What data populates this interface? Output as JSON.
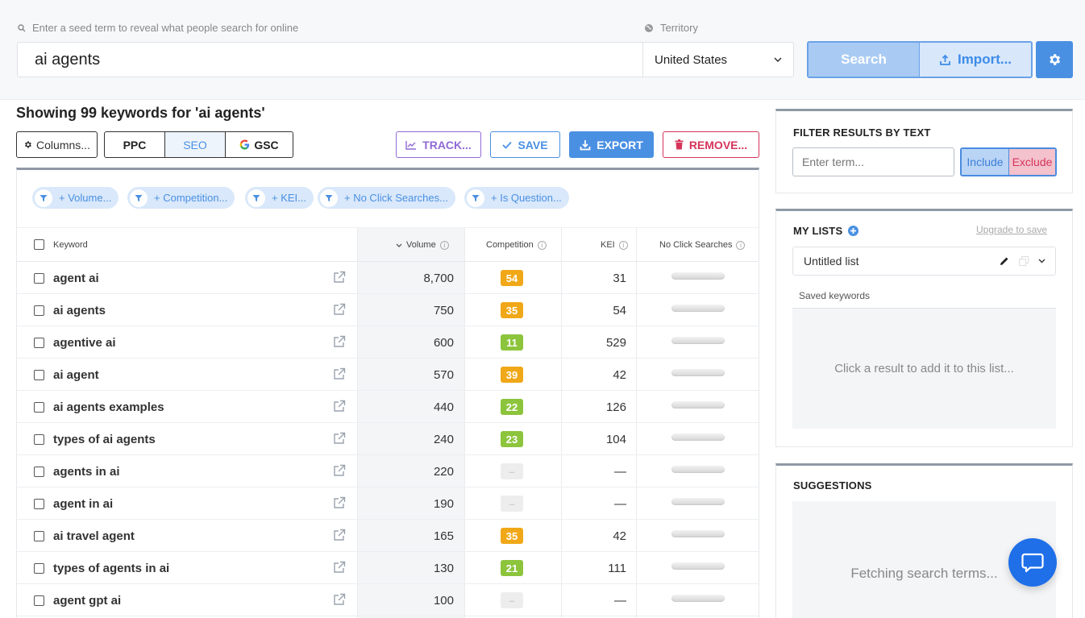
{
  "search": {
    "hint": "Enter a seed term to reveal what people search for online",
    "value": "ai agents",
    "territory_label": "Territory",
    "territory_value": "United States",
    "search_button": "Search",
    "import_button": "Import..."
  },
  "results": {
    "title": "Showing 99 keywords for 'ai agents'"
  },
  "toolbar": {
    "columns": "Columns...",
    "ppc": "PPC",
    "seo": "SEO",
    "gsc": "GSC",
    "track": "TRACK...",
    "save": "SAVE",
    "export": "EXPORT",
    "remove": "REMOVE..."
  },
  "filters": [
    "+ Volume...",
    "+ Competition...",
    "+ KEI...",
    "+ No Click Searches...",
    "+ Is Question..."
  ],
  "table": {
    "headers": {
      "keyword": "Keyword",
      "volume": "Volume",
      "competition": "Competition",
      "kei": "KEI",
      "no_click": "No Click Searches"
    },
    "rows": [
      {
        "keyword": "agent ai",
        "volume": "8,700",
        "competition": "54",
        "kei": "31"
      },
      {
        "keyword": "ai agents",
        "volume": "750",
        "competition": "35",
        "kei": "54"
      },
      {
        "keyword": "agentive ai",
        "volume": "600",
        "competition": "11",
        "kei": "529"
      },
      {
        "keyword": "ai agent",
        "volume": "570",
        "competition": "39",
        "kei": "42"
      },
      {
        "keyword": "ai agents examples",
        "volume": "440",
        "competition": "22",
        "kei": "126"
      },
      {
        "keyword": "types of ai agents",
        "volume": "240",
        "competition": "23",
        "kei": "104"
      },
      {
        "keyword": "agents in ai",
        "volume": "220",
        "competition": "–",
        "kei": "—"
      },
      {
        "keyword": "agent in ai",
        "volume": "190",
        "competition": "–",
        "kei": "—"
      },
      {
        "keyword": "ai travel agent",
        "volume": "165",
        "competition": "35",
        "kei": "42"
      },
      {
        "keyword": "types of agents in ai",
        "volume": "130",
        "competition": "21",
        "kei": "111"
      },
      {
        "keyword": "agent gpt ai",
        "volume": "100",
        "competition": "–",
        "kei": "—"
      }
    ]
  },
  "filter_panel": {
    "title": "FILTER RESULTS BY TEXT",
    "placeholder": "Enter term...",
    "include": "Include",
    "exclude": "Exclude"
  },
  "lists_panel": {
    "title": "MY LISTS",
    "upgrade": "Upgrade to save",
    "list_name": "Untitled list",
    "saved_label": "Saved keywords",
    "empty_text": "Click a result to add it to this list..."
  },
  "suggestions_panel": {
    "title": "SUGGESTIONS",
    "loading": "Fetching search terms..."
  },
  "colors": {
    "accent": "#4a90e2",
    "comp_high": "#f0a818",
    "comp_low": "#8cc43c",
    "comp_none": "#ededed",
    "remove": "#d6345a",
    "track": "#8f6ad6"
  }
}
